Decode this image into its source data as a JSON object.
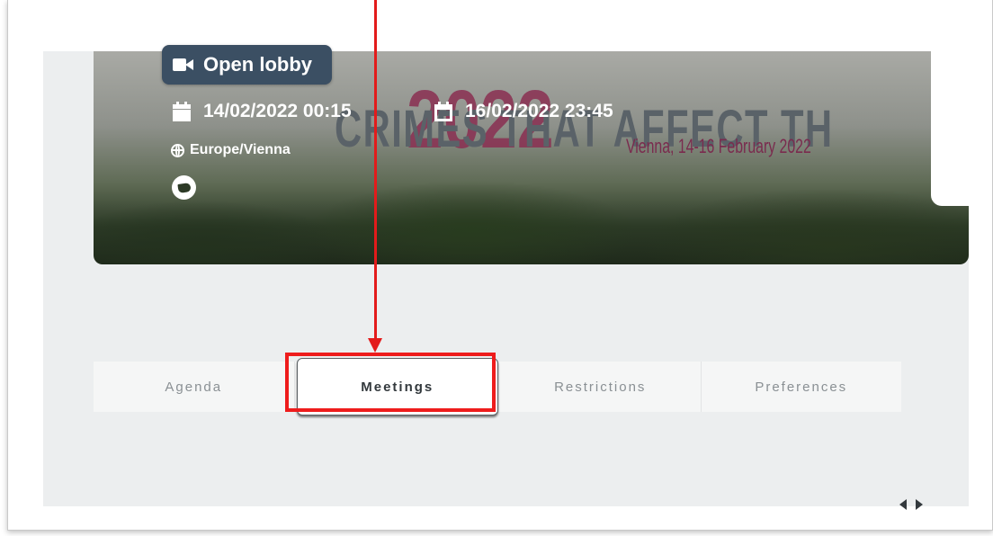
{
  "hero": {
    "year": "2022",
    "headline": "CRIMES THAT AFFECT TH",
    "subtitle": "Vienna, 14-16 February 2022",
    "lobby_label": "Open lobby",
    "start_date": "14/02/2022 00:15",
    "end_date": "16/02/2022 23:45",
    "timezone": "Europe/Vienna"
  },
  "tabs": [
    {
      "label": "Agenda"
    },
    {
      "label": "Meetings"
    },
    {
      "label": "Restrictions"
    },
    {
      "label": "Preferences"
    }
  ],
  "active_tab": "Meetings",
  "colors": {
    "accent_red": "#ee1c1c",
    "lobby_button": "#3b4f63",
    "brand_maroon": "#8a2f52",
    "page_bg": "#eceeef"
  },
  "icons": [
    "video-camera-icon",
    "calendar-icon",
    "calendar-outline-icon",
    "globe-icon",
    "twitter-icon",
    "chevron-left-icon",
    "chevron-right-icon"
  ]
}
